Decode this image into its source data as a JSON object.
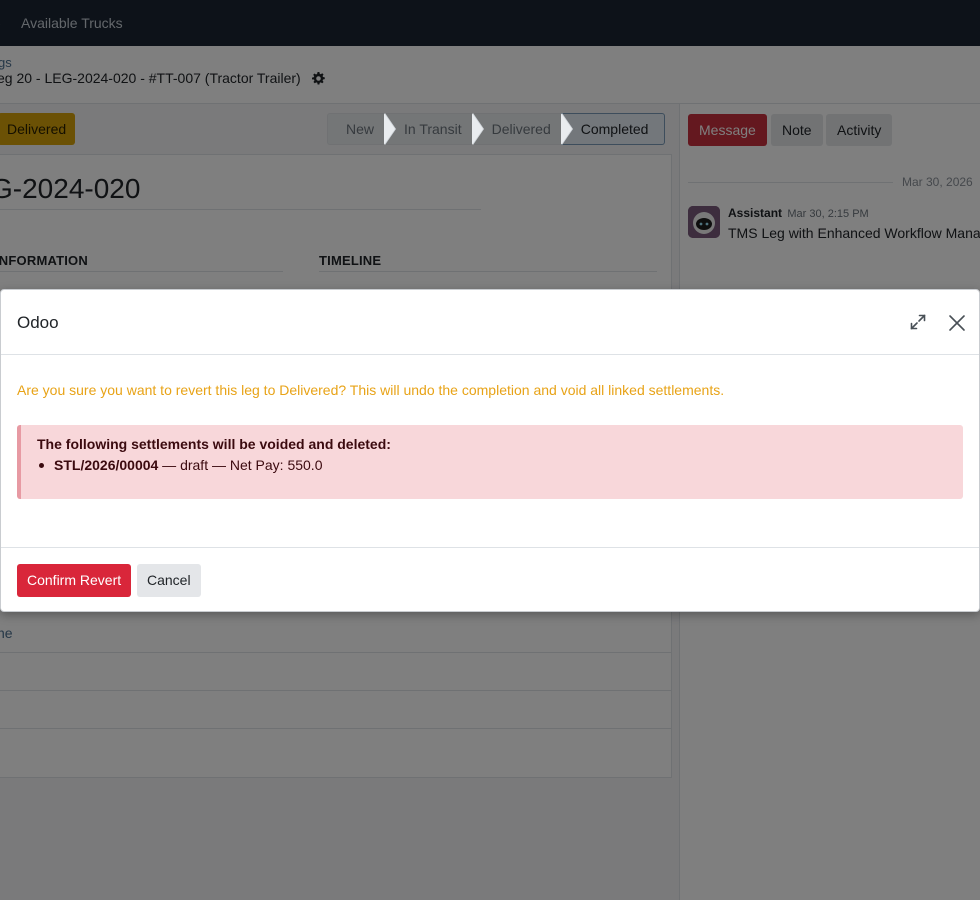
{
  "navbar": {
    "link_label": "Available Trucks"
  },
  "control": {
    "breadcrumb": "gs",
    "record_title": "eg 20 - LEG-2024-020 - #TT-007 (Tractor Trailer)"
  },
  "form": {
    "status_button": "Delivered",
    "stages": [
      {
        "label": "New"
      },
      {
        "label": "In Transit"
      },
      {
        "label": "Delivered"
      },
      {
        "label": "Completed"
      }
    ],
    "leg_name": "G-2024-020",
    "section_info": "INFORMATION",
    "section_timeline": "TIMELINE",
    "link_fragment": "ne"
  },
  "chatter": {
    "btn_message": "Message",
    "btn_note": "Note",
    "btn_activity": "Activity",
    "date_separator": "Mar 30, 2026",
    "author": "Assistant",
    "time": "Mar 30, 2:15 PM",
    "body": "TMS Leg with Enhanced Workflow Mana"
  },
  "dialog": {
    "title": "Odoo",
    "warning": "Are you sure you want to revert this leg to Delivered? This will undo the completion and void all linked settlements.",
    "danger_title": "The following settlements will be voided and deleted:",
    "settlement_ref": "STL/2026/00004",
    "settlement_detail": " — draft — Net Pay: 550.0",
    "confirm_label": "Confirm Revert",
    "cancel_label": "Cancel"
  },
  "colors": {
    "navbar": "#1b2532",
    "warning_text": "#e8a317",
    "danger_bg": "#f8d7da",
    "primary_action": "#d9263a",
    "message_btn": "#c9303e",
    "status_delivered": "#d7a20b"
  }
}
